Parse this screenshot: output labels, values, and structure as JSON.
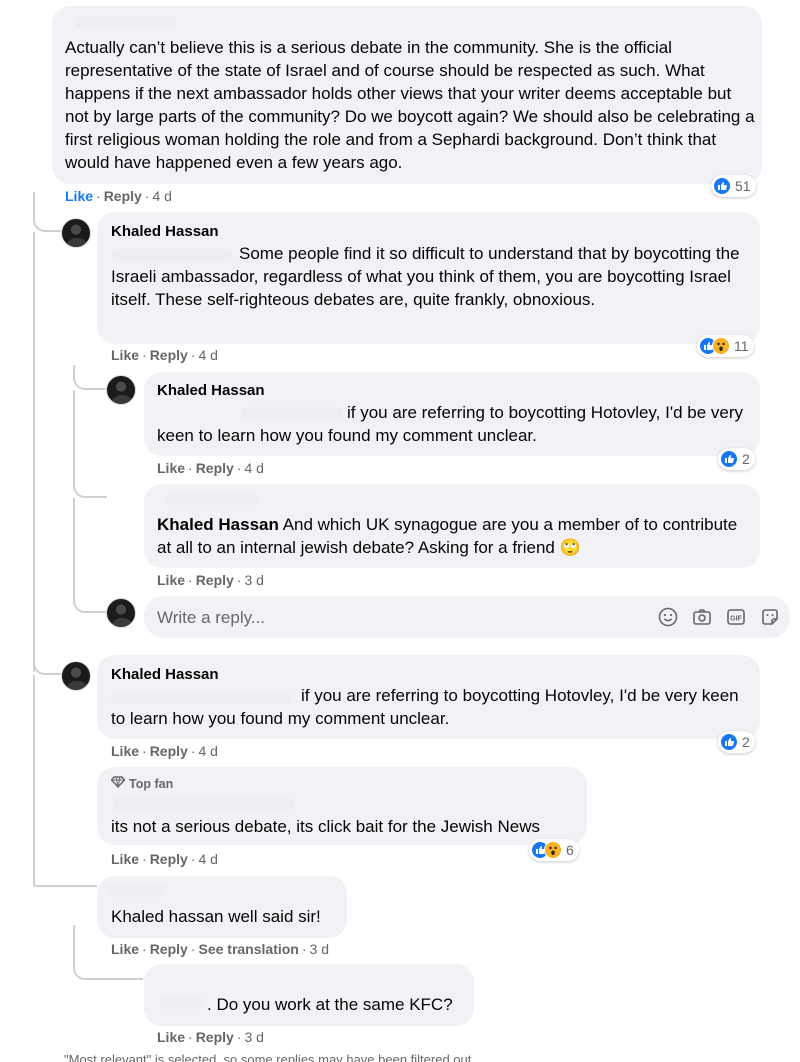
{
  "comments": [
    {
      "text": "Actually can’t believe this is a serious debate in the community. She is the official representative of the state of Israel and of course should be respected as such. What happens if the next ambassador holds other views that your writer deems acceptable but not by large parts of the community? Do we boycott again? We should also be celebrating a first religious woman holding the role and from a Sephardi background. Don’t think that would have happened even a few years ago.",
      "like": "Like",
      "reply": "Reply",
      "time": "4 d",
      "reactions": "51"
    },
    {
      "author": "Khaled Hassan",
      "text": "Some people find it so difficult to understand that by boycotting the Israeli ambassador, regardless of what you think of them, you are boycotting Israel itself. These self-righteous debates are, quite frankly, obnoxious.",
      "like": "Like",
      "reply": "Reply",
      "time": "4 d",
      "reactions": "11"
    },
    {
      "author": "Khaled Hassan",
      "text": "if you are referring to boycotting Hotovley, I'd be very keen to learn how you found my comment unclear.",
      "like": "Like",
      "reply": "Reply",
      "time": "4 d",
      "reactions": "2"
    },
    {
      "author": "Khaled Hassan",
      "text": "And which UK synagogue are you a member of to contribute at all to an internal jewish debate? Asking for a friend",
      "emoji": "🙄",
      "like": "Like",
      "reply": "Reply",
      "time": "3 d"
    },
    {
      "author": "Khaled Hassan",
      "text": "if you are referring to boycotting Hotovley, I'd be very keen to learn how you found my comment unclear.",
      "like": "Like",
      "reply": "Reply",
      "time": "4 d",
      "reactions": "2"
    },
    {
      "badge": "Top fan",
      "text": "its not a serious debate, its click bait for the Jewish News",
      "like": "Like",
      "reply": "Reply",
      "time": "4 d",
      "reactions": "6"
    },
    {
      "text": "Khaled hassan well said sir!",
      "like": "Like",
      "reply": "Reply",
      "see_translation": "See translation",
      "time": "3 d"
    },
    {
      "text": ". Do you work at the same KFC?",
      "like": "Like",
      "reply": "Reply",
      "time": "3 d"
    }
  ],
  "reply_box": {
    "placeholder": "Write a reply..."
  },
  "icons": {
    "like": "like-reaction-icon",
    "wow": "wow-reaction-icon",
    "top_fan": "diamond-icon",
    "emoji": "smiley-icon",
    "camera": "camera-icon",
    "gif": "gif-icon",
    "sticker": "sticker-icon"
  },
  "colors": {
    "accent": "#1877f2",
    "bubble": "#f0f2f5",
    "muted": "#65676b",
    "wow": "#f7b125"
  },
  "footer": {
    "note": "\"Most relevant\" is selected, so some replies may have been filtered out."
  }
}
